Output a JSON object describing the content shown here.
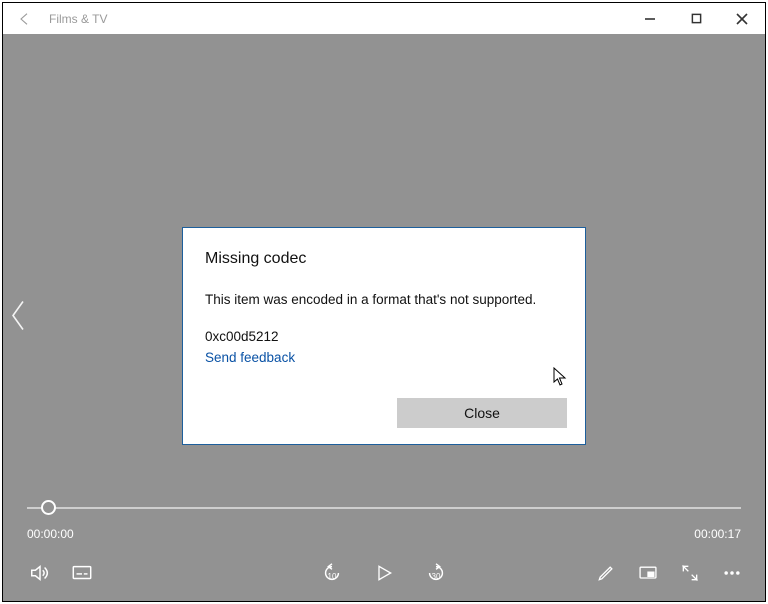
{
  "window": {
    "title": "Films & TV"
  },
  "dialog": {
    "title": "Missing codec",
    "body": "This item was encoded in a format that's not supported.",
    "code": "0xc00d5212",
    "feedback": "Send feedback",
    "close": "Close"
  },
  "player": {
    "time_current": "00:00:00",
    "time_total": "00:00:17",
    "skip_back_label": "10",
    "skip_fwd_label": "30"
  }
}
